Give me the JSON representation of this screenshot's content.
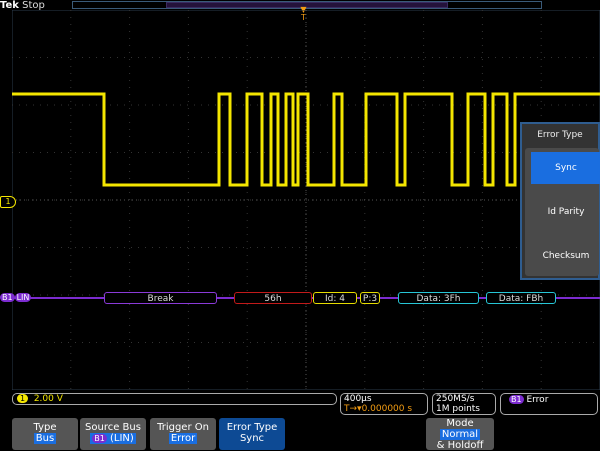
{
  "header": {
    "brand": "Tek",
    "status": "Stop"
  },
  "channel1": {
    "label": "1",
    "scale": "2.00 V",
    "color": "#f4e600"
  },
  "bus": {
    "id": "B1",
    "type": "LIN",
    "color": "#7c2cd0",
    "packets": [
      {
        "text": "Break",
        "color": "#8a3ad8"
      },
      {
        "text": "56h",
        "color": "#c21a1a"
      },
      {
        "text": "Id: 4",
        "color": "#e6dc00"
      },
      {
        "text": "P:3",
        "color": "#e6dc00"
      },
      {
        "text": "Data: 3Fh",
        "color": "#27c6d6"
      },
      {
        "text": "Data: FBh",
        "color": "#27c6d6"
      }
    ]
  },
  "horizontal": {
    "scale": "400µs",
    "position": "0.000000 s"
  },
  "acquisition": {
    "rate": "250MS/s",
    "length": "1M points"
  },
  "trigger": {
    "source": "B1",
    "type": "Error"
  },
  "menu": {
    "title": "Error Type",
    "items": [
      "Sync",
      "Id Parity",
      "Checksum"
    ],
    "selected": "Sync"
  },
  "buttons": [
    {
      "title": "Type",
      "value": "Bus"
    },
    {
      "title": "Source Bus",
      "value_badge": "B1",
      "value": "(LIN)"
    },
    {
      "title": "Trigger On",
      "value": "Error"
    },
    {
      "title": "Error Type",
      "value": "Sync"
    },
    {
      "title": "Mode",
      "value": "Normal",
      "extra": "& Holdoff"
    }
  ]
}
